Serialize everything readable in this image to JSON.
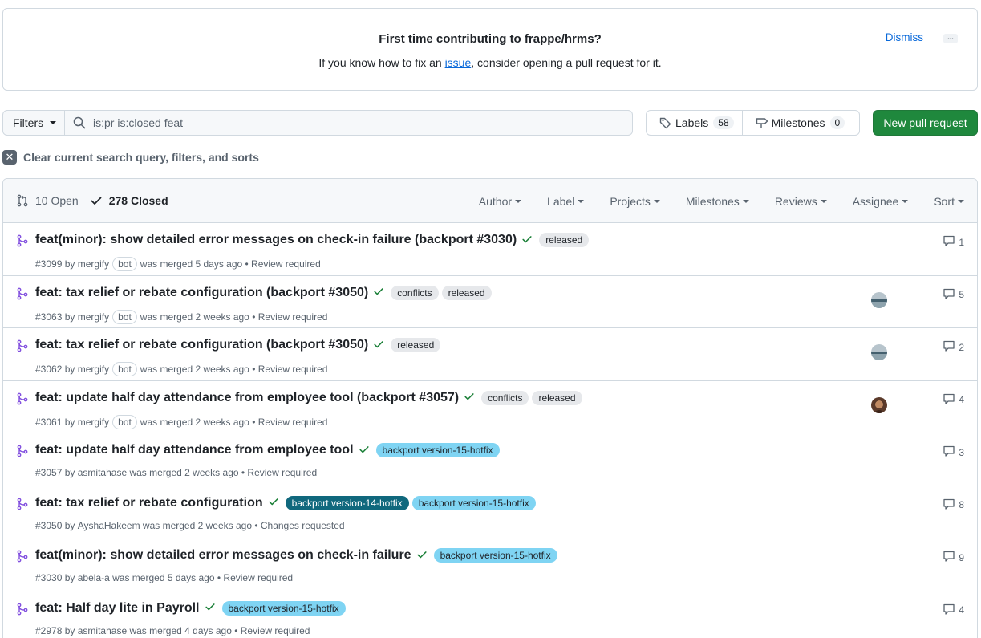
{
  "banner": {
    "title": "First time contributing to frappe/hrms?",
    "text_before": "If you know how to fix an ",
    "link": "issue",
    "text_after": ", consider opening a pull request for it.",
    "dismiss": "Dismiss",
    "more": "..."
  },
  "toolbar": {
    "filters_label": "Filters",
    "search_value": "is:pr is:closed feat",
    "labels_label": "Labels",
    "labels_count": "58",
    "milestones_label": "Milestones",
    "milestones_count": "0",
    "new_pr_label": "New pull request",
    "clear_label": "Clear current search query, filters, and sorts"
  },
  "list_header": {
    "open": "10 Open",
    "closed": "278 Closed",
    "filters": [
      "Author",
      "Label",
      "Projects",
      "Milestones",
      "Reviews",
      "Assignee",
      "Sort"
    ]
  },
  "colors": {
    "merged": "#8250df",
    "check": "#1a7f37",
    "label_gray": "#e6e8eb",
    "label_dark_teal": "#10687d",
    "label_light_blue": "#7fd4f3",
    "primary_green": "#1f883d",
    "link_blue": "#0969da"
  },
  "pulls": [
    {
      "title": "feat(minor): show detailed error messages on check-in failure (backport #3030)",
      "labels": [
        {
          "name": "released",
          "style": "gray"
        }
      ],
      "number": "#3099",
      "by": "by",
      "author": "mergify",
      "bot": "bot",
      "status": "was merged 5 days ago • Review required",
      "comments": "1",
      "avatar": ""
    },
    {
      "title": "feat: tax relief or rebate configuration (backport #3050)",
      "labels": [
        {
          "name": "conflicts",
          "style": "gray"
        },
        {
          "name": "released",
          "style": "gray"
        }
      ],
      "number": "#3063",
      "by": "by",
      "author": "mergify",
      "bot": "bot",
      "status": "was merged 2 weeks ago • Review required",
      "comments": "5",
      "avatar": "landscape"
    },
    {
      "title": "feat: tax relief or rebate configuration (backport #3050)",
      "labels": [
        {
          "name": "released",
          "style": "gray"
        }
      ],
      "number": "#3062",
      "by": "by",
      "author": "mergify",
      "bot": "bot",
      "status": "was merged 2 weeks ago • Review required",
      "comments": "2",
      "avatar": "landscape"
    },
    {
      "title": "feat: update half day attendance from employee tool (backport #3057)",
      "labels": [
        {
          "name": "conflicts",
          "style": "gray"
        },
        {
          "name": "released",
          "style": "gray"
        }
      ],
      "number": "#3061",
      "by": "by",
      "author": "mergify",
      "bot": "bot",
      "status": "was merged 2 weeks ago • Review required",
      "comments": "4",
      "avatar": "person"
    },
    {
      "title": "feat: update half day attendance from employee tool",
      "labels": [
        {
          "name": "backport version-15-hotfix",
          "style": "lightblue"
        }
      ],
      "number": "#3057",
      "by": "by",
      "author": "asmitahase",
      "bot": "",
      "status": "was merged 2 weeks ago • Review required",
      "comments": "3",
      "avatar": ""
    },
    {
      "title": "feat: tax relief or rebate configuration",
      "labels": [
        {
          "name": "backport version-14-hotfix",
          "style": "darkteal"
        },
        {
          "name": "backport version-15-hotfix",
          "style": "lightblue"
        }
      ],
      "number": "#3050",
      "by": "by",
      "author": "AyshaHakeem",
      "bot": "",
      "status": "was merged 2 weeks ago • Changes requested",
      "comments": "8",
      "avatar": ""
    },
    {
      "title": "feat(minor): show detailed error messages on check-in failure",
      "labels": [
        {
          "name": "backport version-15-hotfix",
          "style": "lightblue"
        }
      ],
      "number": "#3030",
      "by": "by",
      "author": "abela-a",
      "bot": "",
      "status": "was merged 5 days ago • Review required",
      "comments": "9",
      "avatar": ""
    },
    {
      "title": "feat: Half day lite in Payroll",
      "labels": [
        {
          "name": "backport version-15-hotfix",
          "style": "lightblue"
        }
      ],
      "number": "#2978",
      "by": "by",
      "author": "asmitahase",
      "bot": "",
      "status": "was merged 4 days ago • Review required",
      "comments": "4",
      "avatar": ""
    }
  ]
}
